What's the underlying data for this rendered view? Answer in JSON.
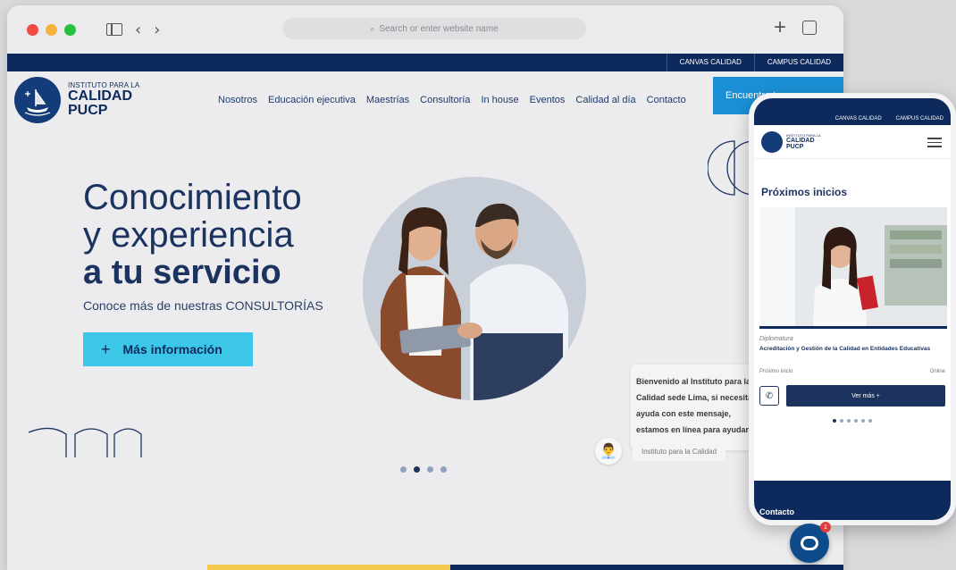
{
  "browser": {
    "address_placeholder": "Search or enter website name"
  },
  "site": {
    "topbar": [
      "CANVAS CALIDAD",
      "CAMPUS CALIDAD"
    ],
    "logo": {
      "line1": "INSTITUTO PARA LA",
      "line2": "CALIDAD",
      "line3": "PUCP"
    },
    "menu": [
      "Nosotros",
      "Educación ejecutiva",
      "Maestrías",
      "Consultoría",
      "In house",
      "Eventos",
      "Calidad al día",
      "Contacto"
    ],
    "cta_label": "Encuentra tu...",
    "hero": {
      "line1": "Conocimiento",
      "line2": "y experiencia",
      "line3": "a tu servicio",
      "subtitle": "Conoce más de nuestras CONSULTORÍAS",
      "button": "Más información",
      "dots": 4,
      "active_dot": 1
    },
    "chat": {
      "message": "Bienvenido al Instituto para la Calidad sede Lima, si necesita ayuda con este mensaje, estamos en línea para ayudarlo.",
      "agent": "Instituto para la Calidad",
      "badge": "1"
    }
  },
  "mobile": {
    "topbar": [
      "CANVAS CALIDAD",
      "CAMPUS CALIDAD"
    ],
    "logo": {
      "line1": "INSTITUTO PARA LA",
      "line2": "CALIDAD",
      "line3": "PUCP"
    },
    "section_title": "Próximos inicios",
    "card": {
      "type": "Diplomatura",
      "title": "Acreditación y Gestión de la Calidad en Entidades Educativas",
      "start_label": "Próximo inicio",
      "modality": "Online",
      "button": "Ver más +"
    },
    "footer_label": "Contacto"
  },
  "colors": {
    "navy": "#0e2a5c",
    "cyan": "#3cc6e8",
    "blue_cta": "#1b8fd6",
    "yellow": "#f2c94c"
  }
}
